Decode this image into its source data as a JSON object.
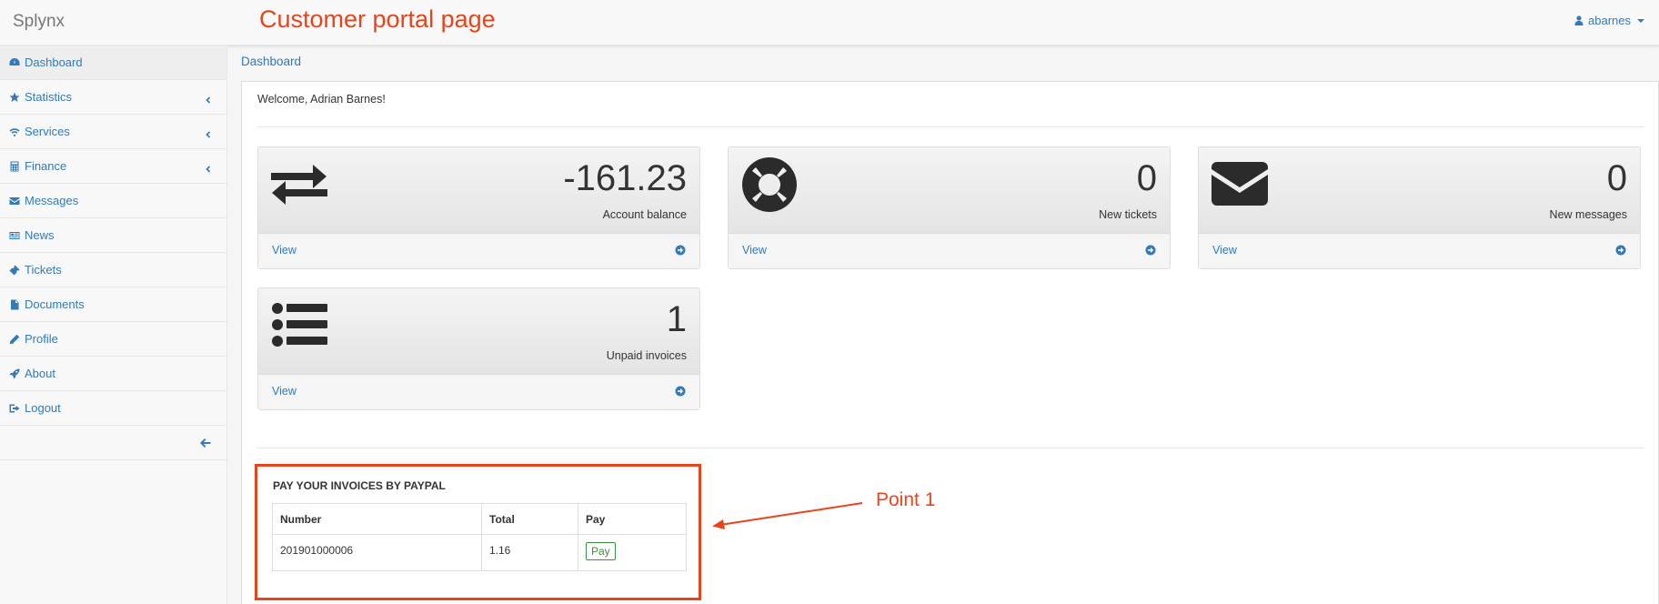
{
  "navbar": {
    "brand": "Splynx",
    "annotation_title": "Customer portal page",
    "user": "abarnes"
  },
  "sidebar": {
    "items": [
      {
        "label": "Dashboard",
        "icon": "dashboard-icon"
      },
      {
        "label": "Statistics",
        "icon": "star-icon"
      },
      {
        "label": "Services",
        "icon": "wifi-icon"
      },
      {
        "label": "Finance",
        "icon": "calculator-icon"
      },
      {
        "label": "Messages",
        "icon": "envelope-icon"
      },
      {
        "label": "News",
        "icon": "newspaper-icon"
      },
      {
        "label": "Tickets",
        "icon": "ticket-icon"
      },
      {
        "label": "Documents",
        "icon": "file-icon"
      },
      {
        "label": "Profile",
        "icon": "pencil-icon"
      },
      {
        "label": "About",
        "icon": "rocket-icon"
      },
      {
        "label": "Logout",
        "icon": "sign-out-icon"
      }
    ]
  },
  "breadcrumb": "Dashboard",
  "main": {
    "welcome": "Welcome, Adrian Barnes!",
    "cards": [
      {
        "value": "-161.23",
        "label": "Account balance",
        "link": "View",
        "icon": "exchange-icon"
      },
      {
        "value": "0",
        "label": "New tickets",
        "link": "View",
        "icon": "life-ring-icon"
      },
      {
        "value": "0",
        "label": "New messages",
        "link": "View",
        "icon": "envelope-icon"
      },
      {
        "value": "1",
        "label": "Unpaid invoices",
        "link": "View",
        "icon": "list-icon"
      }
    ],
    "paypal": {
      "title": "PAY YOUR INVOICES BY PAYPAL",
      "columns": [
        "Number",
        "Total",
        "Pay"
      ],
      "rows": [
        {
          "number": "201901000006",
          "total": "1.16",
          "pay_label": "Pay"
        }
      ]
    }
  },
  "annotation": {
    "label": "Point 1",
    "color": "#e8441c"
  },
  "colors": {
    "link": "#337ab7",
    "annotation": "#e8441c",
    "pay_button": "#3c8f3c"
  }
}
